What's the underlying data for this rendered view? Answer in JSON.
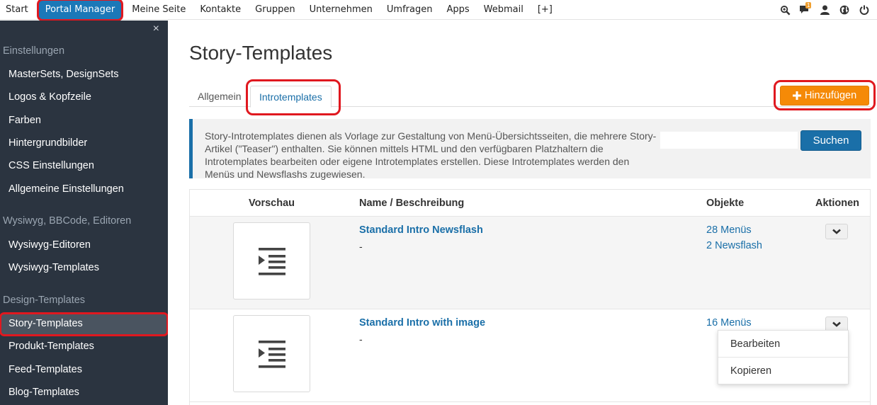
{
  "topnav": {
    "items": [
      "Start",
      "Portal Manager",
      "Meine Seite",
      "Kontakte",
      "Gruppen",
      "Unternehmen",
      "Umfragen",
      "Apps",
      "Webmail",
      "[+]"
    ],
    "active_index": 1,
    "notification_count": "1",
    "icons": [
      "search-zoom-icon",
      "chat-icon",
      "user-icon",
      "globe-icon",
      "power-icon"
    ]
  },
  "sidebar": {
    "close_glyph": "×",
    "sections": [
      {
        "title": "Einstellungen",
        "items": [
          "MasterSets, DesignSets",
          "Logos & Kopfzeile",
          "Farben",
          "Hintergrundbilder",
          "CSS Einstellungen",
          "Allgemeine Einstellungen"
        ]
      },
      {
        "title": "Wysiwyg, BBCode, Editoren",
        "items": [
          "Wysiwyg-Editoren",
          "Wysiwyg-Templates"
        ]
      },
      {
        "title": "Design-Templates",
        "items": [
          "Story-Templates",
          "Produkt-Templates",
          "Feed-Templates",
          "Blog-Templates"
        ]
      }
    ],
    "active_item": "Story-Templates"
  },
  "main": {
    "title": "Story-Templates",
    "tabs": [
      "Allgemein",
      "Introtemplates"
    ],
    "active_tab": "Introtemplates",
    "add_button": "Hinzufügen",
    "info_text": "Story-Introtemplates dienen als Vorlage zur Gestaltung von Menü-Übersichtsseiten, die mehrere Story-Artikel (\"Teaser\") enthalten. Sie können mittels HTML und den verfügbaren Platzhaltern die Introtemplates bearbeiten oder eigene Introtemplates erstellen. Diese Introtemplates werden den Menüs und Newsflashs zugewiesen.",
    "search_value": "",
    "search_placeholder": "",
    "search_button": "Suchen",
    "table": {
      "headers": [
        "Vorschau",
        "Name / Beschreibung",
        "Objekte",
        "Aktionen"
      ],
      "rows": [
        {
          "name": "Standard Intro Newsflash",
          "description": "-",
          "objects": [
            "28 Menüs",
            "2 Newsflash"
          ]
        },
        {
          "name": "Standard Intro with image",
          "description": "-",
          "objects": [
            "16 Menüs"
          ]
        }
      ]
    },
    "dropdown": [
      "Bearbeiten",
      "Kopieren"
    ]
  },
  "colors": {
    "primary_blue": "#1a6fa8",
    "sidebar_bg": "#2b3440",
    "add_orange": "#f58a07",
    "highlight_red": "#e0181f"
  }
}
